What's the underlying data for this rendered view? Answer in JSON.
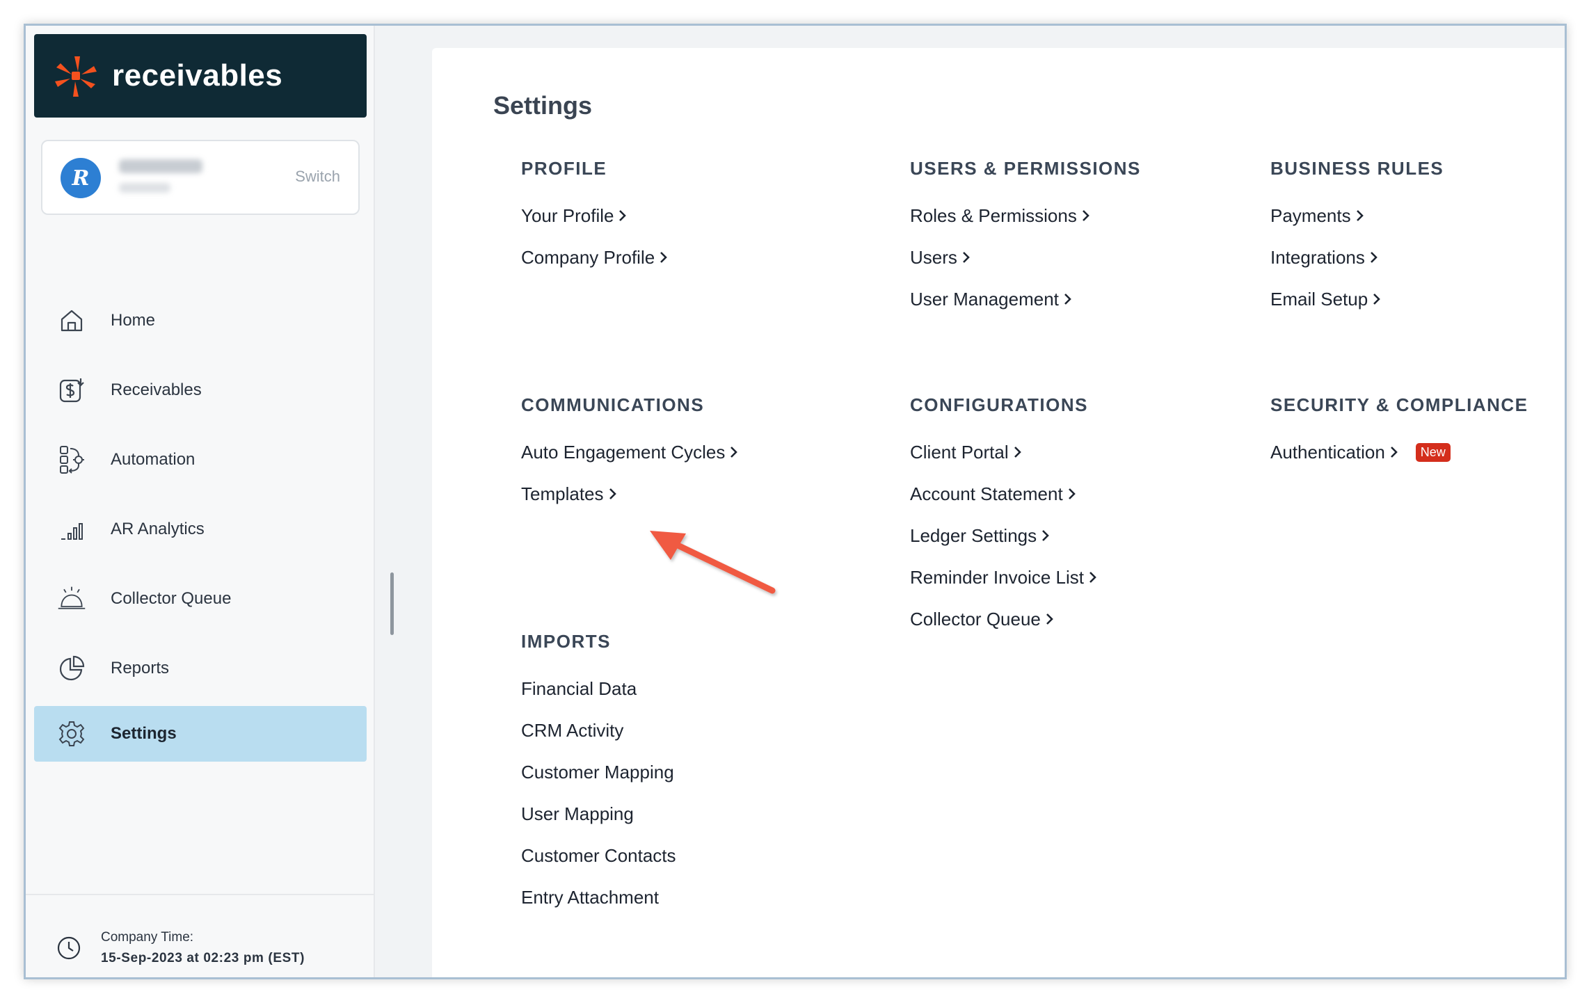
{
  "brand": {
    "name": "receivables",
    "logo_colors": [
      "#f4511e",
      "#ff5a2a"
    ]
  },
  "account": {
    "avatar_letter": "R",
    "switch_label": "Switch"
  },
  "nav": {
    "items": [
      {
        "label": "Home",
        "icon": "home-icon"
      },
      {
        "label": "Receivables",
        "icon": "dollar-doc-icon"
      },
      {
        "label": "Automation",
        "icon": "workflow-icon"
      },
      {
        "label": "AR Analytics",
        "icon": "bar-chart-icon"
      },
      {
        "label": "Collector Queue",
        "icon": "service-bell-icon"
      },
      {
        "label": "Reports",
        "icon": "pie-chart-icon"
      },
      {
        "label": "Settings",
        "icon": "gear-icon",
        "active": true
      }
    ]
  },
  "company_time": {
    "label": "Company Time:",
    "value": "15-Sep-2023 at 02:23 pm (EST)"
  },
  "page": {
    "title": "Settings"
  },
  "sections": {
    "profile": {
      "heading": "PROFILE",
      "links": [
        "Your Profile",
        "Company Profile"
      ]
    },
    "users_permissions": {
      "heading": "USERS & PERMISSIONS",
      "links": [
        "Roles & Permissions",
        "Users",
        "User Management"
      ]
    },
    "business_rules": {
      "heading": "BUSINESS RULES",
      "links": [
        "Payments",
        "Integrations",
        "Email Setup"
      ]
    },
    "communications": {
      "heading": "COMMUNICATIONS",
      "links": [
        "Auto Engagement Cycles",
        "Templates"
      ]
    },
    "configurations": {
      "heading": "CONFIGURATIONS",
      "links": [
        "Client Portal",
        "Account Statement",
        "Ledger Settings",
        "Reminder Invoice List",
        "Collector Queue"
      ]
    },
    "security_compliance": {
      "heading": "SECURITY & COMPLIANCE",
      "links": [
        "Authentication"
      ],
      "badge": "New"
    },
    "imports": {
      "heading": "IMPORTS",
      "links": [
        "Financial Data",
        "CRM Activity",
        "Customer Mapping",
        "User Mapping",
        "Customer Contacts",
        "Entry Attachment"
      ]
    }
  },
  "colors": {
    "sidebar_brand_bg": "#0f2a35",
    "active_nav_bg": "#b9ddf0",
    "new_badge": "#d42e1c",
    "annotation_arrow": "#f05a43"
  }
}
